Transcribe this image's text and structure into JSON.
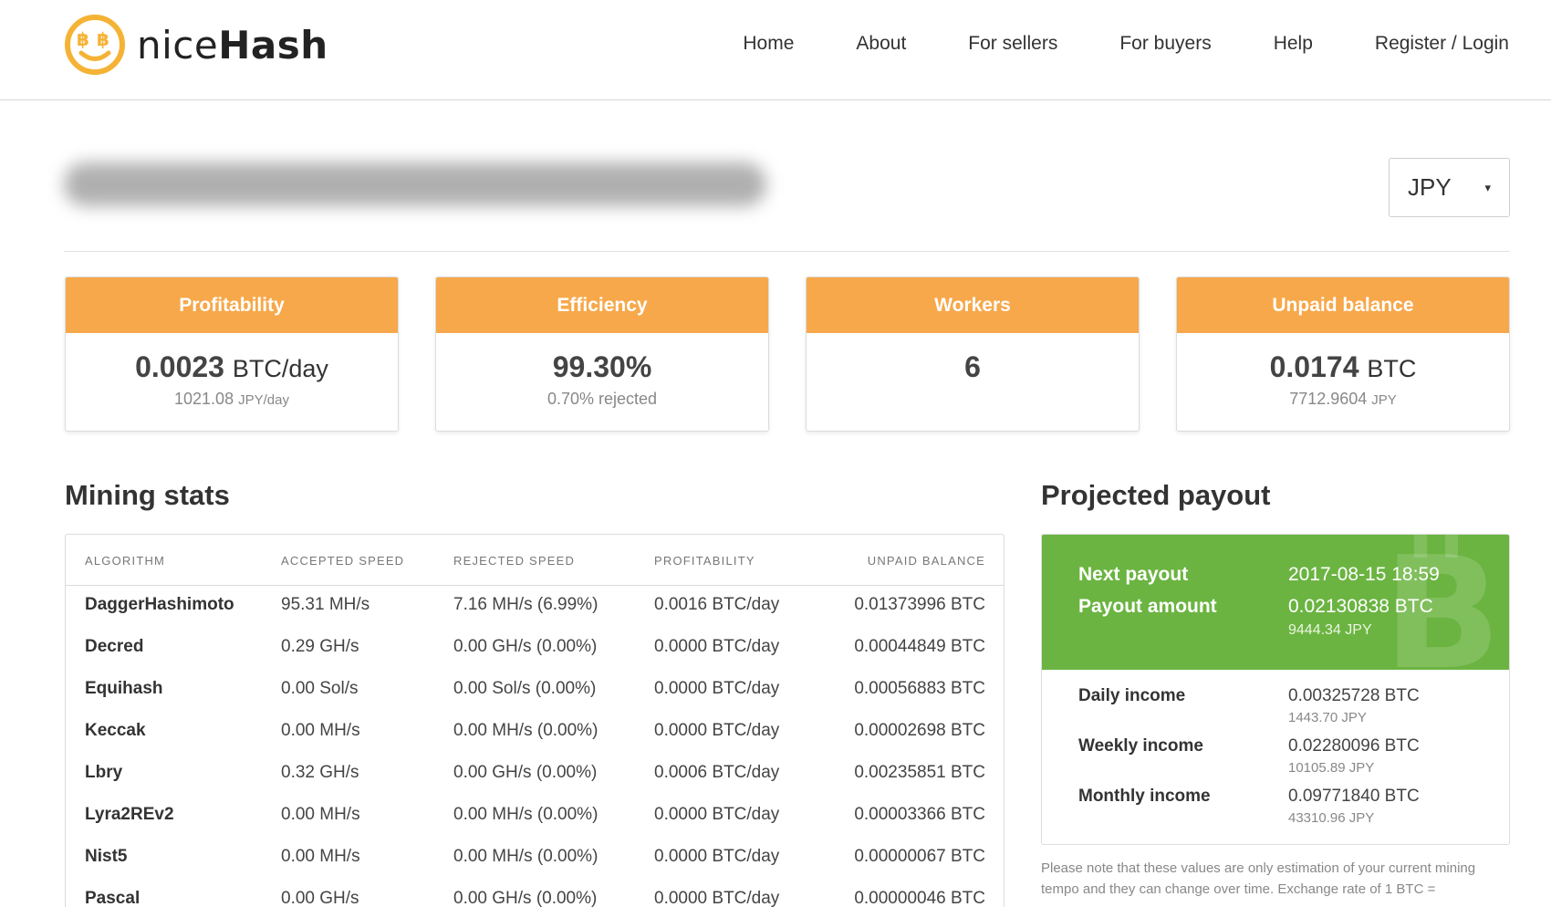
{
  "brand": {
    "logo_light": "nice",
    "logo_bold": "Hash"
  },
  "nav": [
    {
      "label": "Home"
    },
    {
      "label": "About"
    },
    {
      "label": "For sellers"
    },
    {
      "label": "For buyers"
    },
    {
      "label": "Help"
    },
    {
      "label": "Register / Login"
    }
  ],
  "currency": {
    "selected": "JPY",
    "caret": "▾"
  },
  "cards": [
    {
      "title": "Profitability",
      "main": "0.0023",
      "unit": "BTC/day",
      "sub_value": "1021.08",
      "sub_unit": "JPY/day"
    },
    {
      "title": "Efficiency",
      "main": "99.30%",
      "unit": "",
      "sub_value": "0.70% rejected",
      "sub_unit": ""
    },
    {
      "title": "Workers",
      "main": "6",
      "unit": "",
      "sub_value": "",
      "sub_unit": ""
    },
    {
      "title": "Unpaid balance",
      "main": "0.0174",
      "unit": "BTC",
      "sub_value": "7712.9604",
      "sub_unit": "JPY"
    }
  ],
  "mining": {
    "title": "Mining stats",
    "columns": [
      "ALGORITHM",
      "ACCEPTED SPEED",
      "REJECTED SPEED",
      "PROFITABILITY",
      "UNPAID BALANCE"
    ],
    "rows": [
      [
        "DaggerHashimoto",
        "95.31 MH/s",
        "7.16 MH/s (6.99%)",
        "0.0016 BTC/day",
        "0.01373996 BTC"
      ],
      [
        "Decred",
        "0.29 GH/s",
        "0.00 GH/s (0.00%)",
        "0.0000 BTC/day",
        "0.00044849 BTC"
      ],
      [
        "Equihash",
        "0.00 Sol/s",
        "0.00 Sol/s (0.00%)",
        "0.0000 BTC/day",
        "0.00056883 BTC"
      ],
      [
        "Keccak",
        "0.00 MH/s",
        "0.00 MH/s (0.00%)",
        "0.0000 BTC/day",
        "0.00002698 BTC"
      ],
      [
        "Lbry",
        "0.32 GH/s",
        "0.00 GH/s (0.00%)",
        "0.0006 BTC/day",
        "0.00235851 BTC"
      ],
      [
        "Lyra2REv2",
        "0.00 MH/s",
        "0.00 MH/s (0.00%)",
        "0.0000 BTC/day",
        "0.00003366 BTC"
      ],
      [
        "Nist5",
        "0.00 MH/s",
        "0.00 MH/s (0.00%)",
        "0.0000 BTC/day",
        "0.00000067 BTC"
      ],
      [
        "Pascal",
        "0.00 GH/s",
        "0.00 GH/s (0.00%)",
        "0.0000 BTC/day",
        "0.00000046 BTC"
      ]
    ]
  },
  "payout": {
    "title": "Projected payout",
    "next_label": "Next payout",
    "next_value": "2017-08-15 18:59",
    "amount_label": "Payout amount",
    "amount_value": "0.02130838 BTC",
    "amount_jpy": "9444.34 JPY",
    "incomes": [
      {
        "label": "Daily income",
        "btc": "0.00325728 BTC",
        "jpy": "1443.70 JPY"
      },
      {
        "label": "Weekly income",
        "btc": "0.02280096 BTC",
        "jpy": "10105.89 JPY"
      },
      {
        "label": "Monthly income",
        "btc": "0.09771840 BTC",
        "jpy": "43310.96 JPY"
      }
    ],
    "note": "Please note that these values are only estimation of your current mining tempo and they can change over time. Exchange rate of 1 BTC ="
  },
  "colors": {
    "accent_orange": "#f7a84a",
    "payout_green": "#6bb441",
    "logo_yellow": "#f5b335"
  }
}
